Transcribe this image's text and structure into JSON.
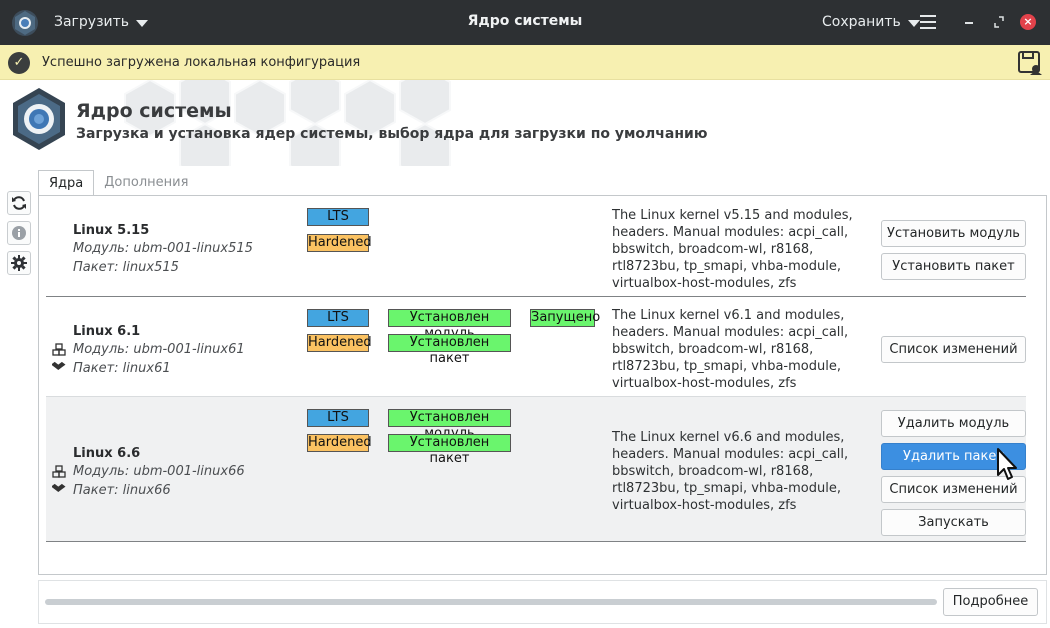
{
  "titlebar": {
    "load_menu": "Загрузить",
    "title": "Ядро системы",
    "save_menu": "Сохранить",
    "icons": [
      "app-logo-icon",
      "menu-icon",
      "minimize-icon",
      "maximize-icon",
      "close-icon"
    ]
  },
  "banner": {
    "message": "Успешно загружена локальная конфигурация",
    "icons": [
      "check-icon",
      "save-config-icon"
    ]
  },
  "header": {
    "title": "Ядро системы",
    "subtitle": "Загрузка и установка ядер системы, выбор ядра для загрузки по умолчанию"
  },
  "tabs": [
    {
      "label": "Ядра",
      "active": true
    },
    {
      "label": "Дополнения",
      "active": false
    }
  ],
  "sidebar": {
    "icons": [
      "refresh-icon",
      "info-icon",
      "settings-icon"
    ]
  },
  "kernels": [
    {
      "name": "Linux 5.15",
      "module": "Модуль: ubm-001-linux515",
      "package": "Пакет: linux515",
      "badges": {
        "lts": "LTS",
        "hardened": "Hardened"
      },
      "description": "The Linux kernel v5.15 and modules, headers. Manual modules: acpi_call, bbswitch, broadcom-wl, r8168, rtl8723bu, tp_smapi, vhba-module, virtualbox-host-modules, zfs",
      "buttons": [
        "Установить модуль",
        "Установить пакет"
      ]
    },
    {
      "name": "Linux 6.1",
      "module": "Модуль: ubm-001-linux61",
      "package": "Пакет: linux61",
      "badges": {
        "lts": "LTS",
        "hardened": "Hardened",
        "module_installed": "Установлен модуль",
        "package_installed": "Установлен пакет",
        "running": "Запущено"
      },
      "description": "The Linux kernel v6.1 and modules, headers. Manual modules: acpi_call, bbswitch, broadcom-wl, r8168, rtl8723bu, tp_smapi, vhba-module, virtualbox-host-modules, zfs",
      "buttons": [
        "Список изменений"
      ]
    },
    {
      "name": "Linux 6.6",
      "module": "Модуль: ubm-001-linux66",
      "package": "Пакет: linux66",
      "badges": {
        "lts": "LTS",
        "hardened": "Hardened",
        "module_installed": "Установлен модуль",
        "package_installed": "Установлен пакет"
      },
      "description": "The Linux kernel v6.6 and modules, headers. Manual modules: acpi_call, bbswitch, broadcom-wl, r8168, rtl8723bu, tp_smapi, vhba-module, virtualbox-host-modules, zfs",
      "buttons": [
        "Удалить модуль",
        "Удалить пакет",
        "Список изменений",
        "Запускать"
      ]
    }
  ],
  "footer": {
    "more_button": "Подробнее"
  },
  "colors": {
    "titlebar": "#2d3033",
    "banner": "#f7f0b1",
    "lts": "#43a5e0",
    "hardened": "#fbc262",
    "installed": "#6af56d",
    "primary": "#3c8fe1",
    "close": "#e2424b"
  }
}
